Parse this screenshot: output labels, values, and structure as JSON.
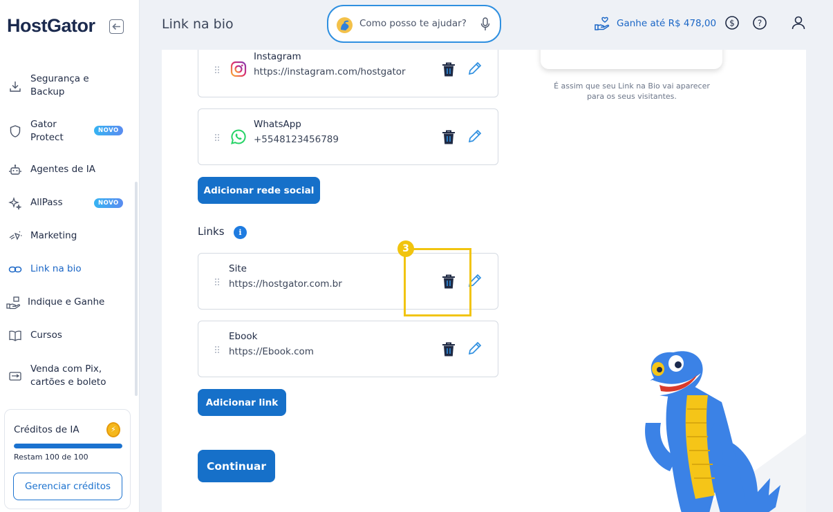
{
  "brand": {
    "logo": "HostGator"
  },
  "sidebar": {
    "items": [
      {
        "label": "Segurança e Backup",
        "icon": "download-icon"
      },
      {
        "label": "Gator Protect",
        "icon": "shield-icon",
        "badge": "NOVO"
      },
      {
        "label": "Agentes de IA",
        "icon": "robot-icon"
      },
      {
        "label": "AllPass",
        "icon": "sparkle-icon",
        "badge": "NOVO"
      },
      {
        "label": "Marketing",
        "icon": "marketing-icon"
      },
      {
        "label": "Link na bio",
        "icon": "link-icon",
        "active": true
      },
      {
        "label": "Indique e Ganhe",
        "icon": "hand-gift-icon"
      },
      {
        "label": "Cursos",
        "icon": "book-icon"
      },
      {
        "label": "Venda com Pix, cartões e boleto",
        "icon": "payment-icon"
      }
    ],
    "credits": {
      "title": "Créditos de IA",
      "remaining_text": "Restam 100 de 100",
      "progress": 1.0,
      "manage_label": "Gerenciar créditos"
    }
  },
  "header": {
    "title": "Link na bio",
    "search_placeholder": "Como posso te ajudar?",
    "earn_label": "Ganhe até R$ 478,00"
  },
  "main": {
    "social": [
      {
        "name": "Instagram",
        "url": "https://instagram.com/hostgator",
        "icon": "instagram-icon"
      },
      {
        "name": "WhatsApp",
        "url": "+5548123456789",
        "icon": "whatsapp-icon"
      }
    ],
    "add_social_label": "Adicionar rede social",
    "links_title": "Links",
    "links": [
      {
        "name": "Site",
        "url": "https://hostgator.com.br"
      },
      {
        "name": "Ebook",
        "url": "https://Ebook.com"
      }
    ],
    "add_link_label": "Adicionar link",
    "continue_label": "Continuar",
    "step_number": "3",
    "preview_caption": "É assim que seu Link na Bio vai aparecer para os seus visitantes."
  },
  "colors": {
    "accent": "#1670c9",
    "highlight": "#f1c40f",
    "badge": "#36b3f2"
  }
}
